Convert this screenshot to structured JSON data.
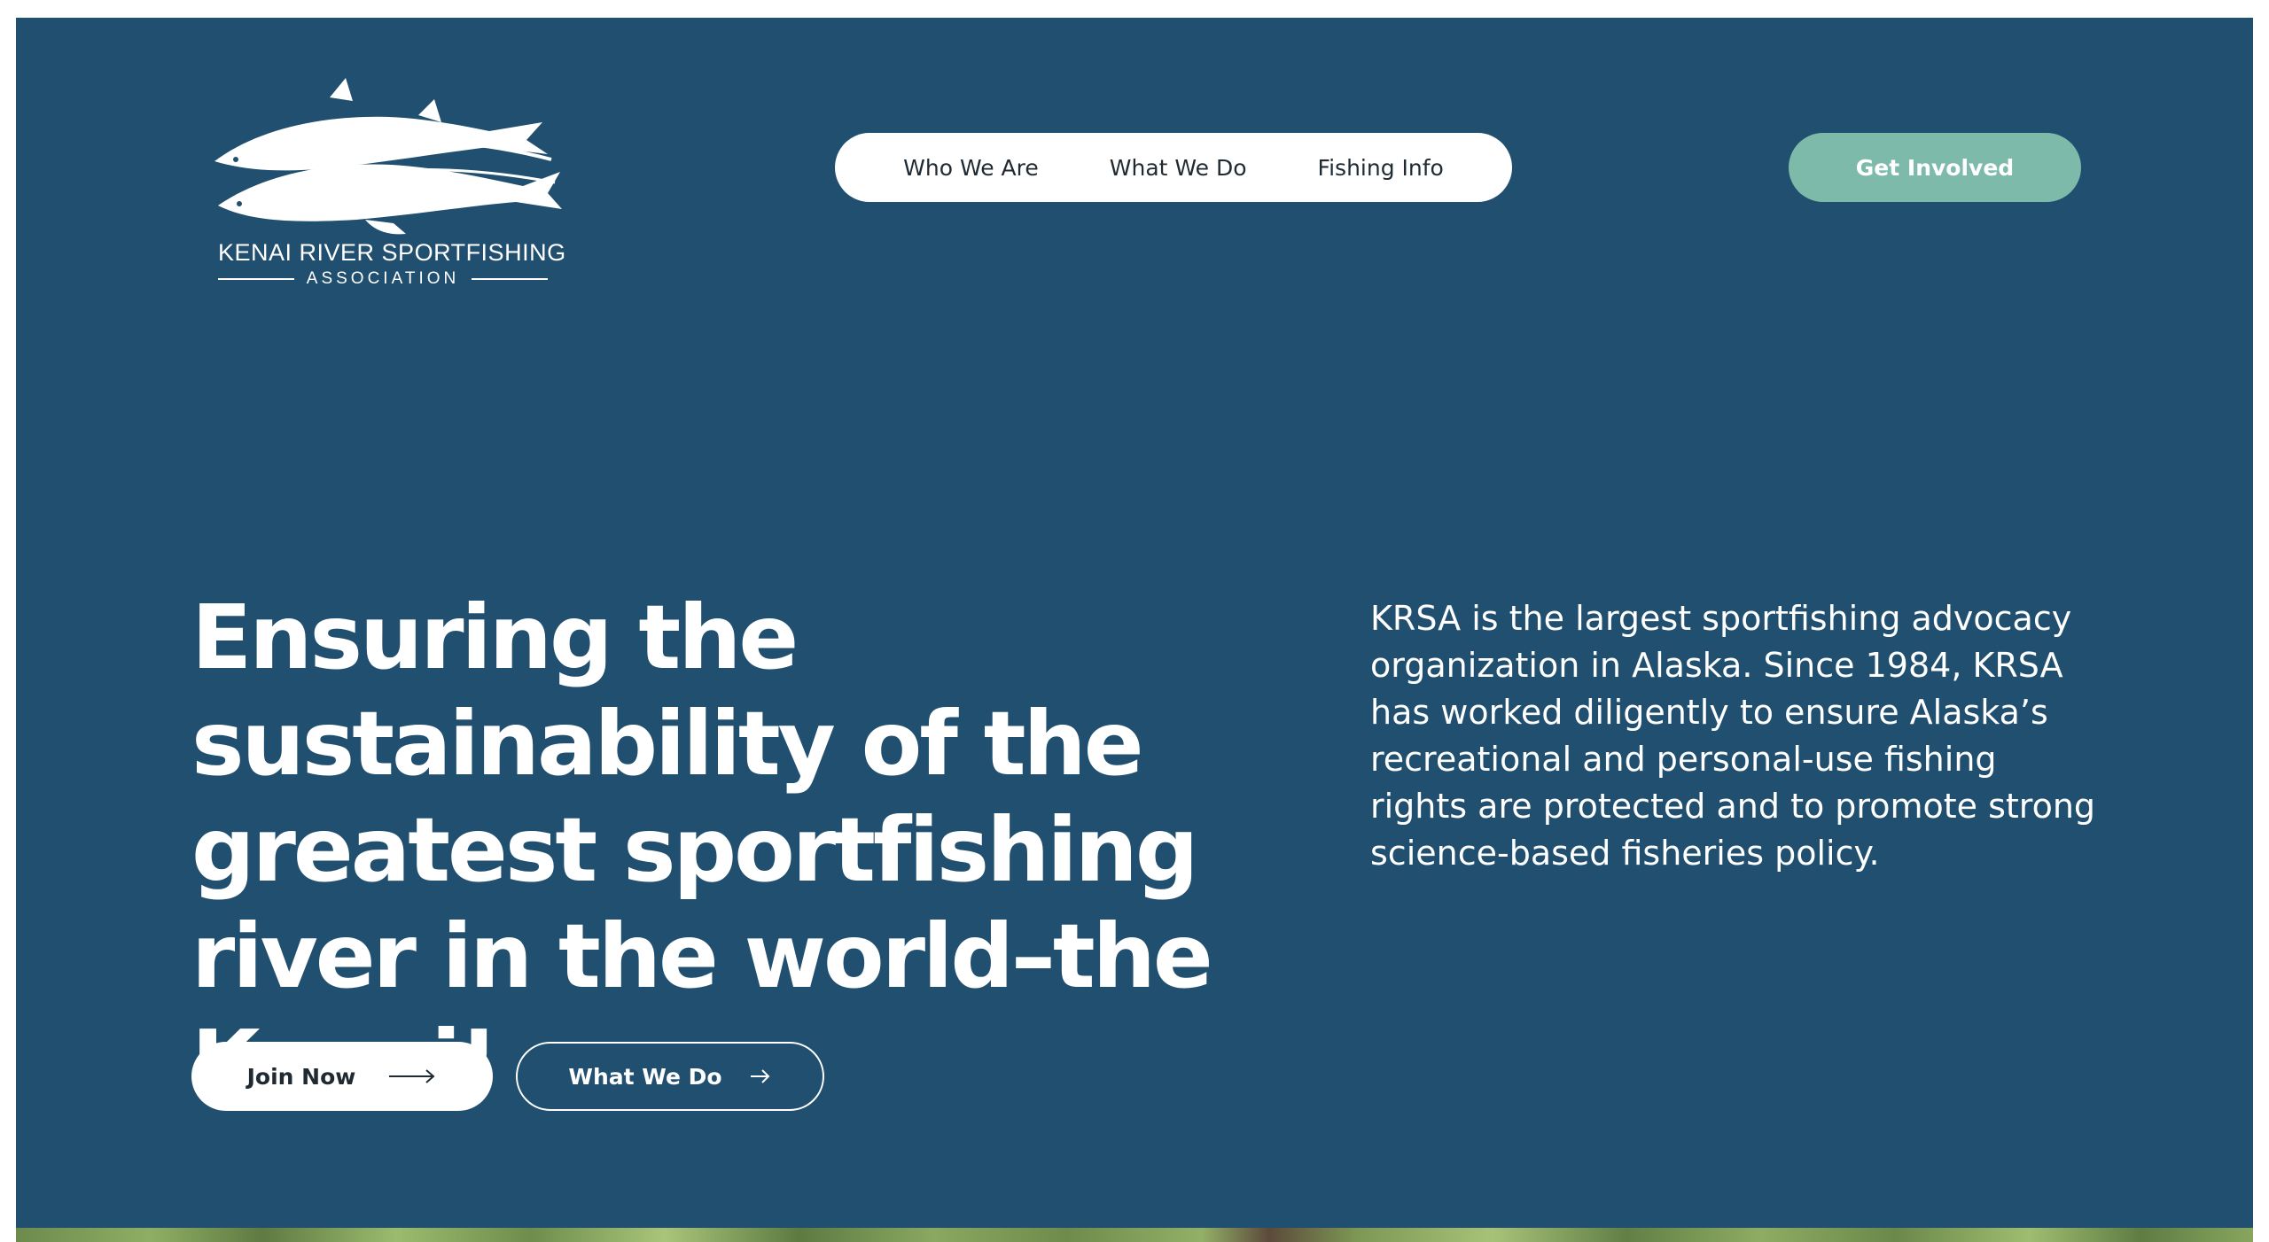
{
  "brand": {
    "name": "KENAI RIVER SPORTFISHING",
    "subtitle": "ASSOCIATION",
    "logo_icon": "salmon-logo-icon",
    "colors": {
      "background": "#214f6f",
      "accent": "#7ebaaa",
      "text": "#ffffff"
    }
  },
  "nav": {
    "items": [
      {
        "label": "Who We Are"
      },
      {
        "label": "What We Do"
      },
      {
        "label": "Fishing Info"
      }
    ]
  },
  "header_cta": {
    "label": "Get Involved"
  },
  "hero": {
    "title": "Ensuring the sustainability of the greatest sportfishing river in the world–the Kenai!",
    "description": "KRSA is the largest sportfishing advocacy organization in Alaska. Since 1984, KRSA has worked diligently to ensure Alaska’s recreational and personal-use fishing rights are protected and to promote strong science-based fisheries policy.",
    "buttons": [
      {
        "label": "Join Now",
        "icon": "long-arrow-right-icon"
      },
      {
        "label": "What We Do",
        "icon": "arrow-right-icon"
      }
    ]
  }
}
